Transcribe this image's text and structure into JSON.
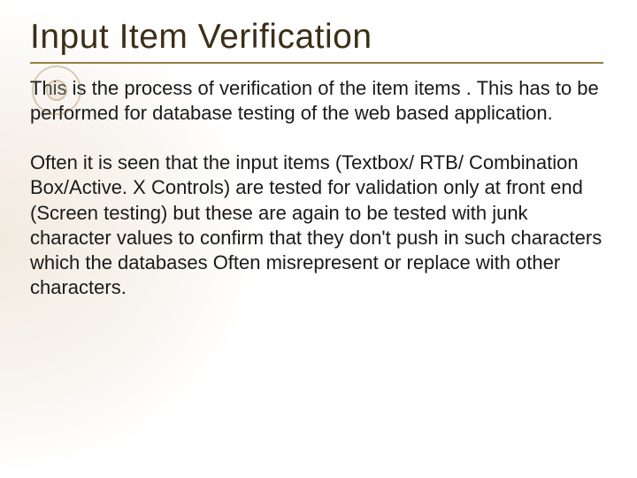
{
  "title": "Input Item Verification",
  "paragraph1": "This is the process of verification of the item items . This has to be performed for database testing of the web based application.",
  "paragraph2": "Often it is seen that the input items (Textbox/ RTB/ Combination Box/Active. X Controls) are tested for validation only at front end (Screen testing) but these are again to be tested with junk character values to confirm that they don't push in such characters which the databases Often misrepresent or replace with other characters."
}
